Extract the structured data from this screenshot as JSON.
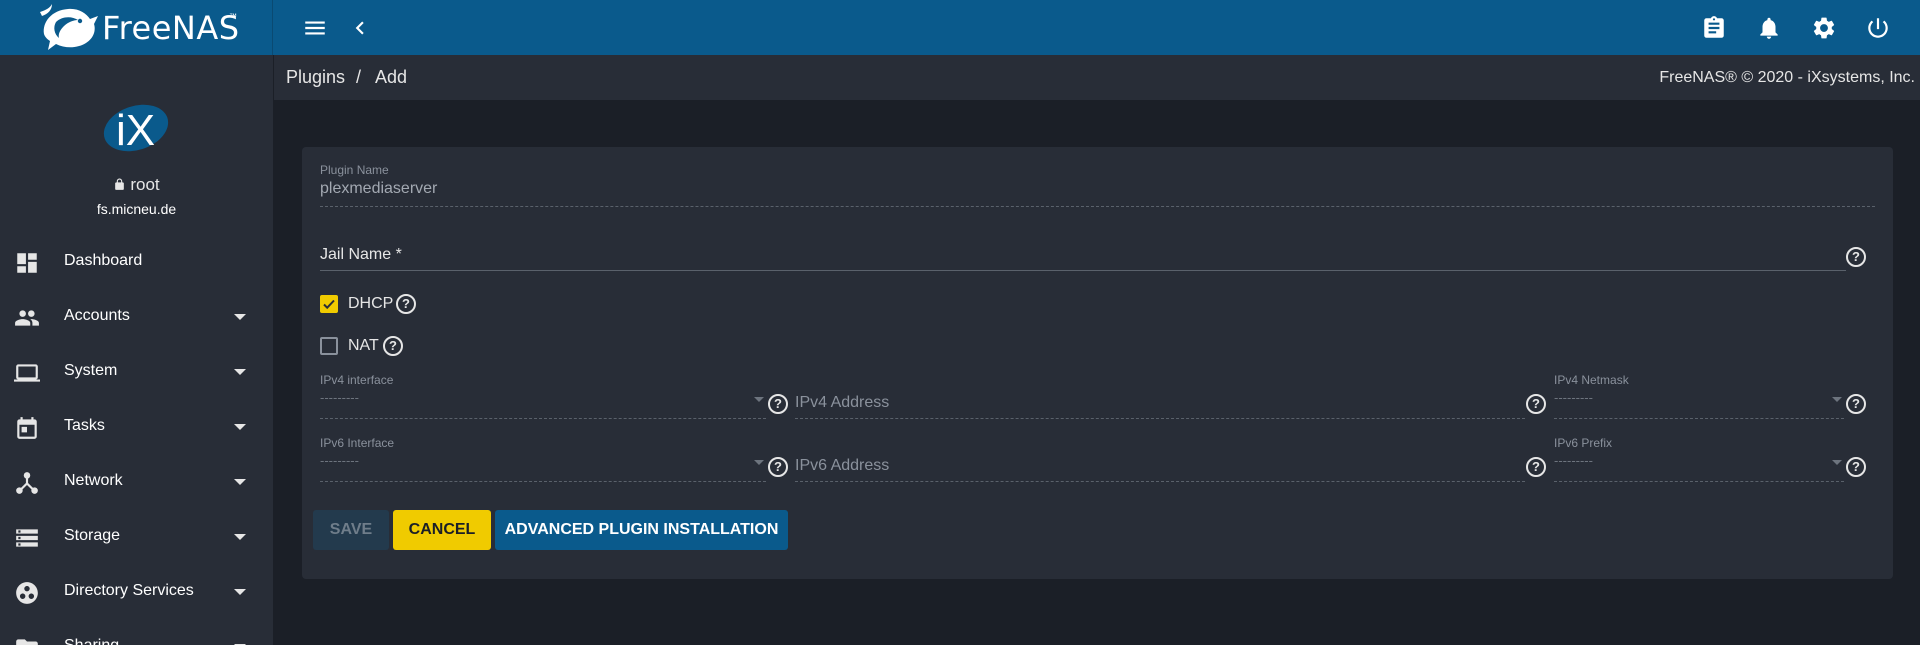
{
  "app": {
    "name": "FreeNAS",
    "trademark": "™"
  },
  "topbar": {
    "icons": [
      "menu-icon",
      "back-icon",
      "clipboard-icon",
      "bell-icon",
      "gear-icon",
      "power-icon"
    ]
  },
  "user": {
    "avatar_text": "iX",
    "username": "root",
    "hostname": "fs.micneu.de"
  },
  "sidebar": {
    "items": [
      {
        "label": "Dashboard",
        "icon": "dashboard-icon",
        "expandable": false
      },
      {
        "label": "Accounts",
        "icon": "people-icon",
        "expandable": true
      },
      {
        "label": "System",
        "icon": "laptop-icon",
        "expandable": true
      },
      {
        "label": "Tasks",
        "icon": "calendar-icon",
        "expandable": true
      },
      {
        "label": "Network",
        "icon": "network-icon",
        "expandable": true
      },
      {
        "label": "Storage",
        "icon": "storage-icon",
        "expandable": true
      },
      {
        "label": "Directory Services",
        "icon": "directory-icon",
        "expandable": true
      },
      {
        "label": "Sharing",
        "icon": "folder-icon",
        "expandable": true
      }
    ]
  },
  "breadcrumb": {
    "parent": "Plugins",
    "separator": "/",
    "current": "Add"
  },
  "copyright": "FreeNAS® © 2020 - iXsystems, Inc.",
  "form": {
    "plugin_name": {
      "label": "Plugin Name",
      "value": "plexmediaserver"
    },
    "jail_name": {
      "label": "Jail Name *"
    },
    "dhcp": {
      "label": "DHCP",
      "checked": true
    },
    "nat": {
      "label": "NAT",
      "checked": false
    },
    "ipv4_interface": {
      "label": "IPv4 interface",
      "value": "---------"
    },
    "ipv4_address": {
      "placeholder": "IPv4 Address"
    },
    "ipv4_netmask": {
      "label": "IPv4 Netmask",
      "value": "---------"
    },
    "ipv6_interface": {
      "label": "IPv6 Interface",
      "value": "---------"
    },
    "ipv6_address": {
      "placeholder": "IPv6 Address"
    },
    "ipv6_prefix": {
      "label": "IPv6 Prefix",
      "value": "---------"
    },
    "help_glyph": "?"
  },
  "buttons": {
    "save": "Save",
    "cancel": "Cancel",
    "advanced": "Advanced Plugin Installation"
  },
  "colors": {
    "topbar": "#0a5a8c",
    "panel": "#282d37",
    "background": "#1b1f27",
    "accent": "#f0cb00",
    "primary_button": "#0a5a8c",
    "disabled_button": "#233a4d"
  }
}
